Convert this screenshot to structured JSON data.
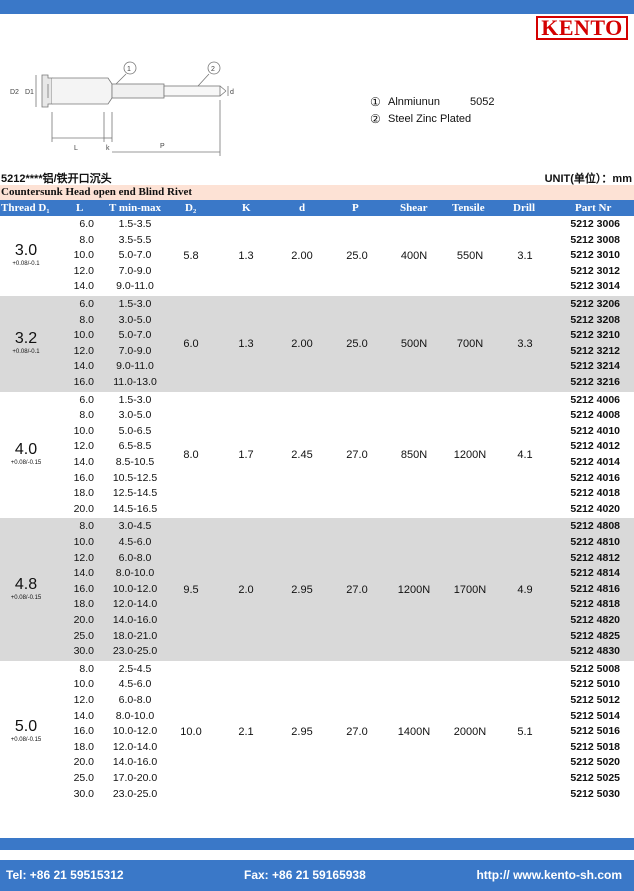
{
  "brand": {
    "logo_text": "KENTO",
    "color": "#d40000"
  },
  "colors": {
    "accent": "#3a78c8",
    "subtitle_bg": "#fde2d5",
    "shaded_row": "#d9d9d9"
  },
  "diagram": {
    "labels": {
      "d2": "D2",
      "d1": "D1",
      "d": "d",
      "l": "L",
      "k": "k",
      "p": "P",
      "callout1": "1",
      "callout2": "2"
    }
  },
  "legend": [
    {
      "num": "①",
      "material": "Alnmiunun",
      "grade": "5052"
    },
    {
      "num": "②",
      "material": "Steel Zinc Plated",
      "grade": ""
    }
  ],
  "product_code": "5212****铝/铁开口沉头",
  "unit_label": "UNIT(单位）：mm",
  "subtitle": "Countersunk Head open end Blind Rivet",
  "columns": {
    "thread": "Thread D₁",
    "l": "L",
    "t": "T min-max",
    "d2": "D₂",
    "k": "K",
    "d": "d",
    "p": "P",
    "shear": "Shear",
    "tensile": "Tensile",
    "drill": "Drill",
    "part": "Part Nr"
  },
  "groups": [
    {
      "thread": "3.0",
      "tol": "+0.08/-0.1",
      "d2": "5.8",
      "k": "1.3",
      "d": "2.00",
      "p": "25.0",
      "shear": "400N",
      "tensile": "550N",
      "drill": "3.1",
      "shaded": false,
      "rows": [
        {
          "l": "6.0",
          "t": "1.5-3.5",
          "part": "5212 3006"
        },
        {
          "l": "8.0",
          "t": "3.5-5.5",
          "part": "5212 3008"
        },
        {
          "l": "10.0",
          "t": "5.0-7.0",
          "part": "5212 3010"
        },
        {
          "l": "12.0",
          "t": "7.0-9.0",
          "part": "5212 3012"
        },
        {
          "l": "14.0",
          "t": "9.0-11.0",
          "part": "5212 3014"
        }
      ]
    },
    {
      "thread": "3.2",
      "tol": "+0.08/-0.1",
      "d2": "6.0",
      "k": "1.3",
      "d": "2.00",
      "p": "25.0",
      "shear": "500N",
      "tensile": "700N",
      "drill": "3.3",
      "shaded": true,
      "rows": [
        {
          "l": "6.0",
          "t": "1.5-3.0",
          "part": "5212 3206"
        },
        {
          "l": "8.0",
          "t": "3.0-5.0",
          "part": "5212 3208"
        },
        {
          "l": "10.0",
          "t": "5.0-7.0",
          "part": "5212 3210"
        },
        {
          "l": "12.0",
          "t": "7.0-9.0",
          "part": "5212 3212"
        },
        {
          "l": "14.0",
          "t": "9.0-11.0",
          "part": "5212 3214"
        },
        {
          "l": "16.0",
          "t": "11.0-13.0",
          "part": "5212 3216"
        }
      ]
    },
    {
      "thread": "4.0",
      "tol": "+0.08/-0.15",
      "d2": "8.0",
      "k": "1.7",
      "d": "2.45",
      "p": "27.0",
      "shear": "850N",
      "tensile": "1200N",
      "drill": "4.1",
      "shaded": false,
      "rows": [
        {
          "l": "6.0",
          "t": "1.5-3.0",
          "part": "5212 4006"
        },
        {
          "l": "8.0",
          "t": "3.0-5.0",
          "part": "5212 4008"
        },
        {
          "l": "10.0",
          "t": "5.0-6.5",
          "part": "5212 4010"
        },
        {
          "l": "12.0",
          "t": "6.5-8.5",
          "part": "5212 4012"
        },
        {
          "l": "14.0",
          "t": "8.5-10.5",
          "part": "5212 4014"
        },
        {
          "l": "16.0",
          "t": "10.5-12.5",
          "part": "5212 4016"
        },
        {
          "l": "18.0",
          "t": "12.5-14.5",
          "part": "5212 4018"
        },
        {
          "l": "20.0",
          "t": "14.5-16.5",
          "part": "5212 4020"
        }
      ]
    },
    {
      "thread": "4.8",
      "tol": "+0.08/-0.15",
      "d2": "9.5",
      "k": "2.0",
      "d": "2.95",
      "p": "27.0",
      "shear": "1200N",
      "tensile": "1700N",
      "drill": "4.9",
      "shaded": true,
      "rows": [
        {
          "l": "8.0",
          "t": "3.0-4.5",
          "part": "5212 4808"
        },
        {
          "l": "10.0",
          "t": "4.5-6.0",
          "part": "5212 4810"
        },
        {
          "l": "12.0",
          "t": "6.0-8.0",
          "part": "5212 4812"
        },
        {
          "l": "14.0",
          "t": "8.0-10.0",
          "part": "5212 4814"
        },
        {
          "l": "16.0",
          "t": "10.0-12.0",
          "part": "5212 4816"
        },
        {
          "l": "18.0",
          "t": "12.0-14.0",
          "part": "5212 4818"
        },
        {
          "l": "20.0",
          "t": "14.0-16.0",
          "part": "5212 4820"
        },
        {
          "l": "25.0",
          "t": "18.0-21.0",
          "part": "5212 4825"
        },
        {
          "l": "30.0",
          "t": "23.0-25.0",
          "part": "5212 4830"
        }
      ]
    },
    {
      "thread": "5.0",
      "tol": "+0.08/-0.15",
      "d2": "10.0",
      "k": "2.1",
      "d": "2.95",
      "p": "27.0",
      "shear": "1400N",
      "tensile": "2000N",
      "drill": "5.1",
      "shaded": false,
      "rows": [
        {
          "l": "8.0",
          "t": "2.5-4.5",
          "part": "5212 5008"
        },
        {
          "l": "10.0",
          "t": "4.5-6.0",
          "part": "5212 5010"
        },
        {
          "l": "12.0",
          "t": "6.0-8.0",
          "part": "5212 5012"
        },
        {
          "l": "14.0",
          "t": "8.0-10.0",
          "part": "5212 5014"
        },
        {
          "l": "16.0",
          "t": "10.0-12.0",
          "part": "5212 5016"
        },
        {
          "l": "18.0",
          "t": "12.0-14.0",
          "part": "5212 5018"
        },
        {
          "l": "20.0",
          "t": "14.0-16.0",
          "part": "5212 5020"
        },
        {
          "l": "25.0",
          "t": "17.0-20.0",
          "part": "5212 5025"
        },
        {
          "l": "30.0",
          "t": "23.0-25.0",
          "part": "5212 5030"
        }
      ]
    }
  ],
  "footer": {
    "tel": "Tel: +86 21 59515312",
    "fax": "Fax: +86 21 59165938",
    "web": "http:// www.kento-sh.com"
  }
}
